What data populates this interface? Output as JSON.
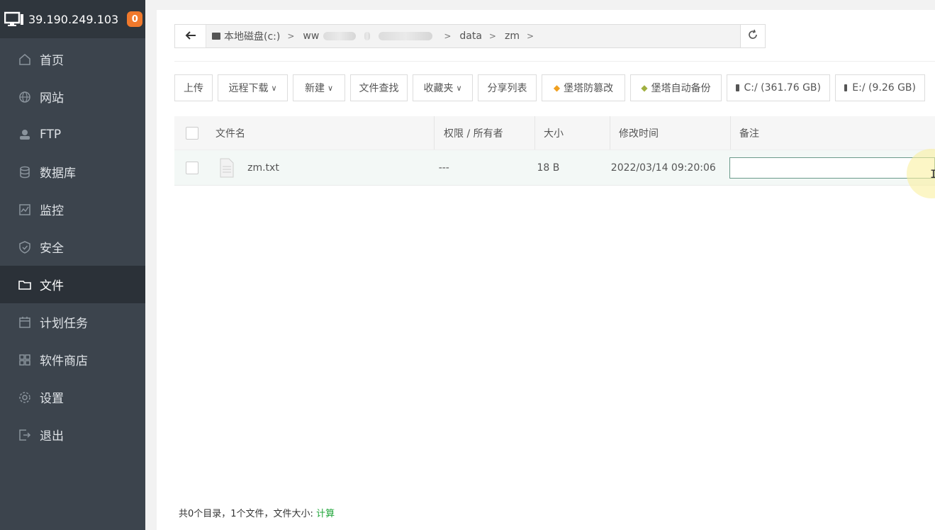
{
  "sidebar": {
    "ip": "39.190.249.103",
    "badge": "0",
    "items": [
      {
        "label": "首页",
        "icon": "home-icon"
      },
      {
        "label": "网站",
        "icon": "globe-icon"
      },
      {
        "label": "FTP",
        "icon": "ftp-icon"
      },
      {
        "label": "数据库",
        "icon": "database-icon"
      },
      {
        "label": "监控",
        "icon": "monitor-icon"
      },
      {
        "label": "安全",
        "icon": "shield-icon"
      },
      {
        "label": "文件",
        "icon": "folder-icon"
      },
      {
        "label": "计划任务",
        "icon": "calendar-icon"
      },
      {
        "label": "软件商店",
        "icon": "grid-icon"
      },
      {
        "label": "设置",
        "icon": "gear-icon"
      },
      {
        "label": "退出",
        "icon": "logout-icon"
      }
    ],
    "active_index": 6
  },
  "path": {
    "disk": "本地磁盘(c:)",
    "seg1": "ww",
    "seg2": "data",
    "seg3": "zm"
  },
  "toolbar": {
    "upload": "上传",
    "remote_download": "远程下载",
    "new": "新建",
    "file_search": "文件查找",
    "favorites": "收藏夹",
    "share_list": "分享列表",
    "tamper": "堡塔防篡改",
    "auto_backup": "堡塔自动备份",
    "disk_c": "C:/ (361.76 GB)",
    "disk_e": "E:/ (9.26 GB)"
  },
  "table": {
    "headers": {
      "name": "文件名",
      "perm": "权限 / 所有者",
      "size": "大小",
      "mtime": "修改时间",
      "note": "备注"
    },
    "rows": [
      {
        "name": "zm.txt",
        "perm": "---",
        "size": "18 B",
        "mtime": "2022/03/14 09:20:06",
        "note": ""
      }
    ]
  },
  "footer": {
    "summary": "共0个目录，1个文件，文件大小:",
    "calc": "计算"
  },
  "colors": {
    "sidebar_bg": "#3c444d",
    "sidebar_active": "#2b3138",
    "badge": "#f0792c",
    "accent_green": "#20a53a"
  }
}
